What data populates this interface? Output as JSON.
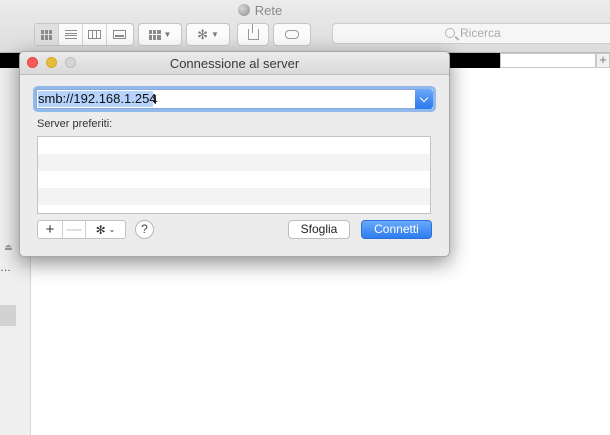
{
  "finder": {
    "window_title": "Rete",
    "search_placeholder": "Ricerca",
    "icons": [
      "globe-icon",
      "icon-view-icon",
      "list-view-icon",
      "column-view-icon",
      "gallery-view-icon",
      "arrange-icon",
      "gear-icon",
      "share-icon",
      "tag-icon",
      "search-icon"
    ]
  },
  "sidebar": {
    "ellipsis": "…"
  },
  "dialog": {
    "title": "Connessione al server",
    "server_address": "smb://192.168.1.254",
    "favorites_label": "Server preferiti:",
    "favorites": [],
    "buttons": {
      "add": "+",
      "remove": "—",
      "help": "?",
      "browse": "Sfoglia",
      "connect": "Connetti"
    },
    "colors": {
      "accent": "#2d7cf0",
      "close": "#fc5b57",
      "minimize": "#e5bf3c",
      "zoom": "#d5d5d5"
    }
  }
}
